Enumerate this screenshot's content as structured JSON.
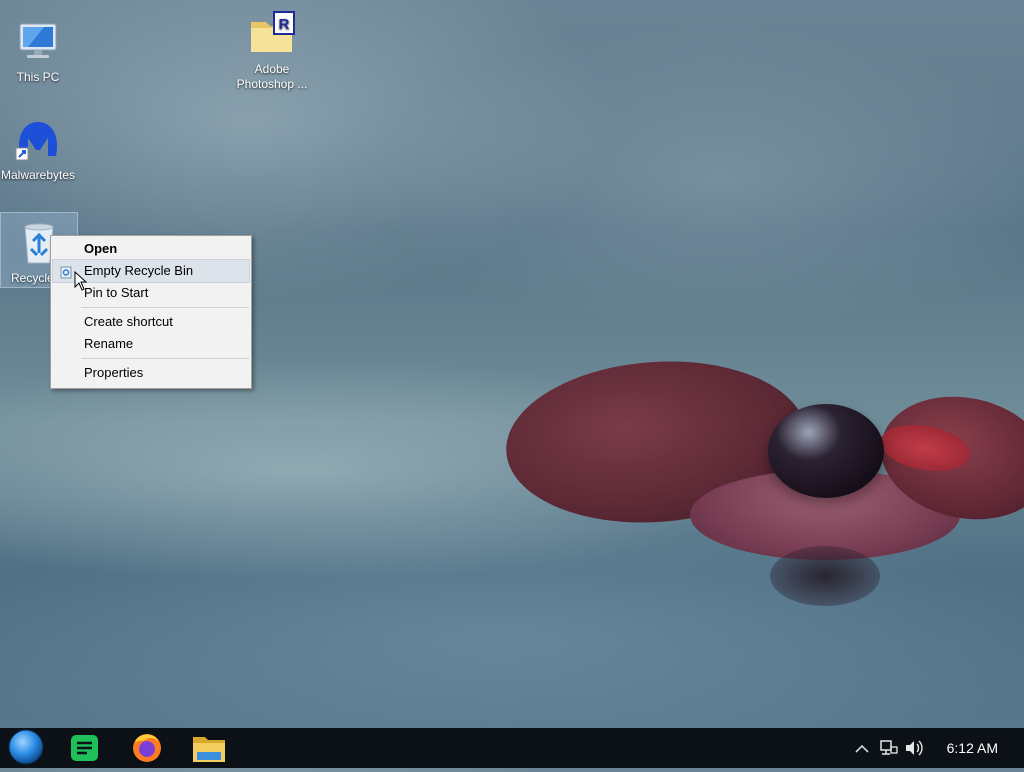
{
  "desktop": {
    "icons": [
      {
        "label": "This PC",
        "icon": "computer-icon"
      },
      {
        "label": "Adobe Photoshop ...",
        "label_line1": "Adobe",
        "label_line2": "Photoshop ...",
        "icon": "folder-r-icon"
      },
      {
        "label": "Malwarebytes",
        "icon": "malwarebytes-icon"
      },
      {
        "label": "Recycle",
        "icon": "recycle-bin-icon"
      }
    ]
  },
  "context_menu": {
    "items": [
      {
        "label": "Open",
        "bold": true
      },
      {
        "label": "Empty Recycle Bin",
        "hovered": true,
        "icon": "recycle-bin-small-icon"
      },
      {
        "label": "Pin to Start"
      },
      {
        "label": "Create shortcut"
      },
      {
        "label": "Rename"
      },
      {
        "label": "Properties"
      }
    ]
  },
  "taskbar": {
    "apps": [
      "start-orb-icon",
      "notes-app-icon",
      "firefox-icon",
      "file-explorer-icon"
    ],
    "tray": [
      "show-hidden-icons-chevron-icon",
      "network-icon",
      "volume-icon"
    ],
    "clock": "6:12 AM"
  },
  "colors": {
    "taskbar": "#0b1116",
    "menu_bg": "#f2f2f2",
    "menu_hover": "#dce3ea"
  }
}
